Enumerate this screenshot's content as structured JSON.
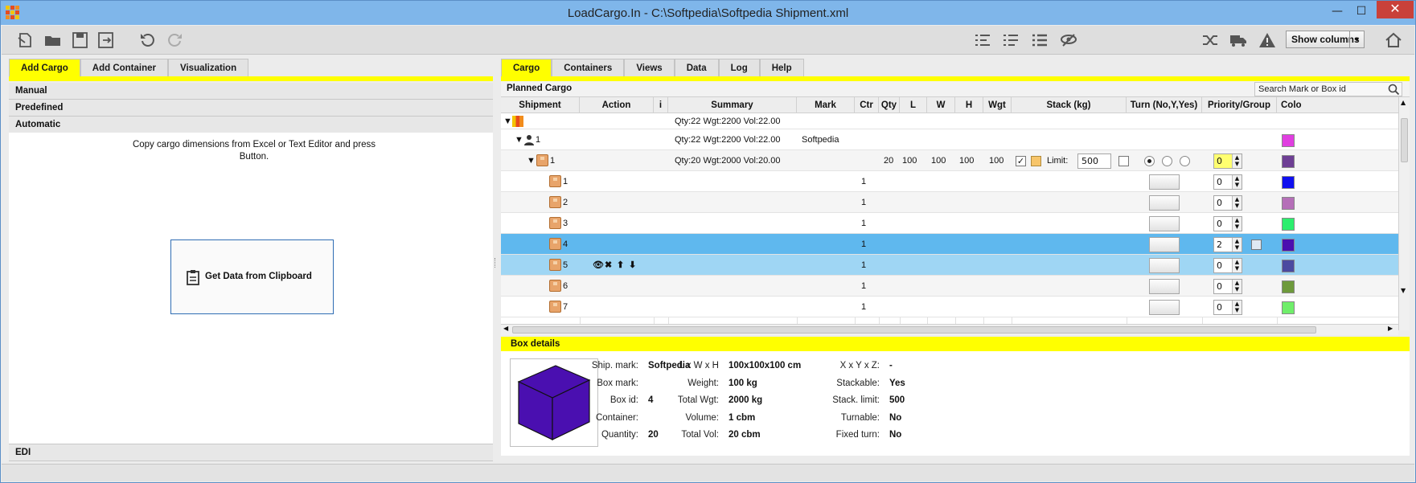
{
  "window": {
    "title": "LoadCargo.In - C:\\Softpedia\\Softpedia Shipment.xml",
    "minimize": "—",
    "maximize": "☐",
    "close": "✕",
    "logo_colors": [
      "#f4c400",
      "#e74c1c",
      "#f28c1c",
      "#e74c1c",
      "#f4c400",
      "#e74c1c",
      "#f28c1c",
      "#e74c1c",
      "#f4c400"
    ]
  },
  "toolbar": {
    "left_icons": [
      "new-file-icon",
      "open-folder-icon",
      "save-icon",
      "save-as-icon",
      "undo-icon",
      "redo-icon"
    ],
    "right_icons": [
      "view-list-1-icon",
      "view-list-2-icon",
      "view-list-3-icon",
      "hide-icon",
      "shuffle-icon",
      "truck-icon",
      "warning-icon"
    ],
    "show_columns": "Show columns",
    "home_icon": "home-icon"
  },
  "left_panel": {
    "tabs": [
      "Add Cargo",
      "Add Container",
      "Visualization"
    ],
    "active_tab": "Add Cargo",
    "accordion": [
      "Manual",
      "Predefined",
      "Automatic"
    ],
    "automatic_text": "Copy cargo dimensions from Excel or Text Editor and press Button.",
    "clipboard_button": "Get Data from Clipboard",
    "edi": "EDI"
  },
  "right_panel": {
    "tabs": [
      "Cargo",
      "Containers",
      "Views",
      "Data",
      "Log",
      "Help"
    ],
    "active_tab": "Cargo",
    "planned_cargo": "Planned Cargo",
    "search_placeholder": "Search Mark or Box id",
    "columns": [
      "Shipment",
      "Action",
      "i",
      "Summary",
      "Mark",
      "Ctr",
      "Qty",
      "L",
      "W",
      "H",
      "Wgt",
      "Stack (kg)",
      "Turn (No,Y,Yes)",
      "Priority/Group",
      "Colo"
    ],
    "root_row": {
      "summary": "Qty:22 Wgt:2200 Vol:22.00"
    },
    "shipment_row": {
      "id": "1",
      "summary": "Qty:22 Wgt:2200 Vol:22.00",
      "mark": "Softpedia",
      "color": "#e03ee0"
    },
    "group_row": {
      "id": "1",
      "summary": "Qty:20 Wgt:2000 Vol:20.00",
      "qty": "20",
      "l": "100",
      "w": "100",
      "h": "100",
      "wgt": "100",
      "limit_label": "Limit:",
      "limit": "500",
      "priority": "0",
      "color": "#6e3f94"
    },
    "boxes": [
      {
        "id": "1",
        "ctr": "1",
        "priority": "0",
        "color": "#1010f0"
      },
      {
        "id": "2",
        "ctr": "1",
        "priority": "0",
        "color": "#b56fb8"
      },
      {
        "id": "3",
        "ctr": "1",
        "priority": "0",
        "color": "#2cee6e"
      },
      {
        "id": "4",
        "ctr": "1",
        "priority": "2",
        "color": "#4b0fb0"
      },
      {
        "id": "5",
        "ctr": "1",
        "priority": "0",
        "color": "#4b4aa0"
      },
      {
        "id": "6",
        "ctr": "1",
        "priority": "0",
        "color": "#6e9a3c"
      },
      {
        "id": "7",
        "ctr": "1",
        "priority": "0",
        "color": "#6fee6a"
      }
    ],
    "action_icons": [
      "eye-icon",
      "delete-icon",
      "move-up-icon",
      "move-down-icon"
    ]
  },
  "box_details": {
    "title": "Box details",
    "cube_color": "#4a0fb0",
    "col1": [
      {
        "k": "Ship. mark:",
        "v": "Softpedia"
      },
      {
        "k": "Box mark:",
        "v": ""
      },
      {
        "k": "Box id:",
        "v": "4"
      },
      {
        "k": "Container:",
        "v": ""
      },
      {
        "k": "Quantity:",
        "v": "20"
      }
    ],
    "col2": [
      {
        "k": "L x W x H",
        "v": "100x100x100 cm"
      },
      {
        "k": "Weight:",
        "v": "100 kg"
      },
      {
        "k": "Total Wgt:",
        "v": "2000 kg"
      },
      {
        "k": "Volume:",
        "v": "1 cbm"
      },
      {
        "k": "Total Vol:",
        "v": "20 cbm"
      }
    ],
    "col3": [
      {
        "k": "X x Y x Z:",
        "v": "-"
      },
      {
        "k": "Stackable:",
        "v": "Yes"
      },
      {
        "k": "Stack. limit:",
        "v": "500"
      },
      {
        "k": "Turnable:",
        "v": "No"
      },
      {
        "k": "Fixed turn:",
        "v": "No"
      }
    ]
  }
}
